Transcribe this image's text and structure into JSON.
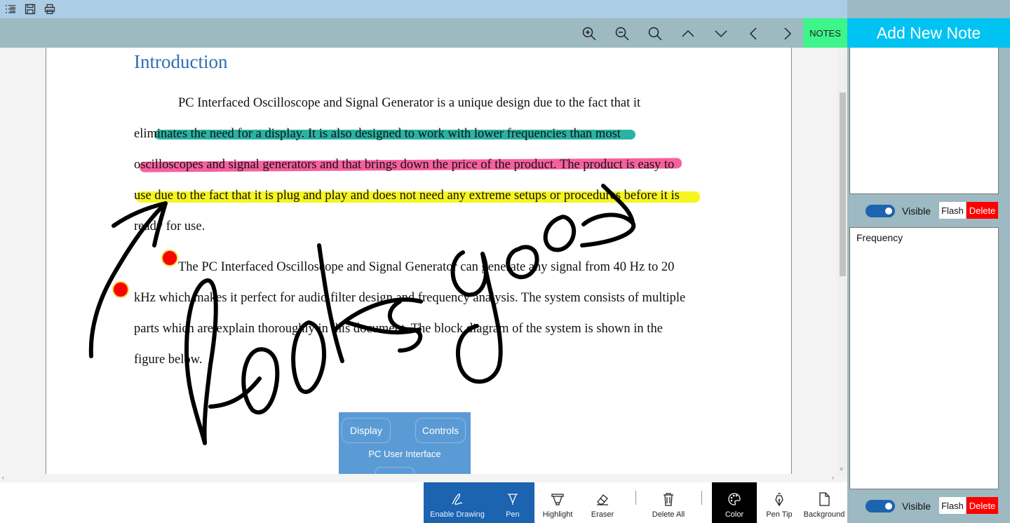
{
  "titlebar": {
    "icons": [
      "list-icon",
      "save-icon",
      "print-icon"
    ]
  },
  "toolbar": {
    "icons": [
      "zoom-in-icon",
      "zoom-out-icon",
      "search-icon",
      "chevron-up-icon",
      "chevron-down-icon",
      "chevron-left-icon",
      "chevron-right-icon"
    ],
    "notes_label": "NOTES"
  },
  "document": {
    "heading": "Introduction",
    "paragraph1": [
      "PC Interfaced Oscilloscope and Signal Generator is a unique design due to the fact that it",
      "eliminates the need for a display. It is also designed to work with lower frequencies than most",
      "oscilloscopes and signal generators and that brings down the price of the product. The product is easy to",
      "use due to the fact that it is plug and play and does not need any extreme setups or procedures before it is",
      "ready for use."
    ],
    "paragraph2": [
      "The PC Interfaced Oscilloscope and Signal Generator can generate any signal from 40 Hz to 20",
      "kHz which makes it perfect for audio filter design and frequency analysis. The system consists of multiple",
      "parts which are explain thoroughly in this document. The block diagram of the system is shown in the",
      "figure below."
    ],
    "highlight_colors": {
      "teal": "#2ab3a3",
      "pink": "#f7609e",
      "yellow": "#f6f51f"
    },
    "block_diagram": {
      "display_label": "Display",
      "controls_label": "Controls",
      "interface_label": "PC User Interface"
    },
    "ink_text": "looks good",
    "ink_color": "#000000",
    "marker_color": "#ff0000"
  },
  "drawbar": {
    "enable_drawing": "Enable Drawing",
    "pen": "Pen",
    "highlight": "Highlight",
    "eraser": "Eraser",
    "delete_all": "Delete All",
    "color": "Color",
    "pen_tip": "Pen Tip",
    "background": "Background"
  },
  "notes": {
    "add_new_note": "Add New Note",
    "items": [
      {
        "text": "",
        "visible_label": "Visible",
        "flash_label": "Flash",
        "delete_label": "Delete",
        "visible": true
      },
      {
        "text": "Frequency",
        "visible_label": "Visible",
        "flash_label": "Flash",
        "delete_label": "Delete",
        "visible": true
      }
    ]
  },
  "colors": {
    "titlebar": "#abcee6",
    "toolbar": "#9db9c1",
    "notes_button": "#3df58a",
    "add_note": "#00c3f2",
    "active_tool": "#1c63b0",
    "delete": "#ff0000",
    "heading": "#2f6db3"
  }
}
